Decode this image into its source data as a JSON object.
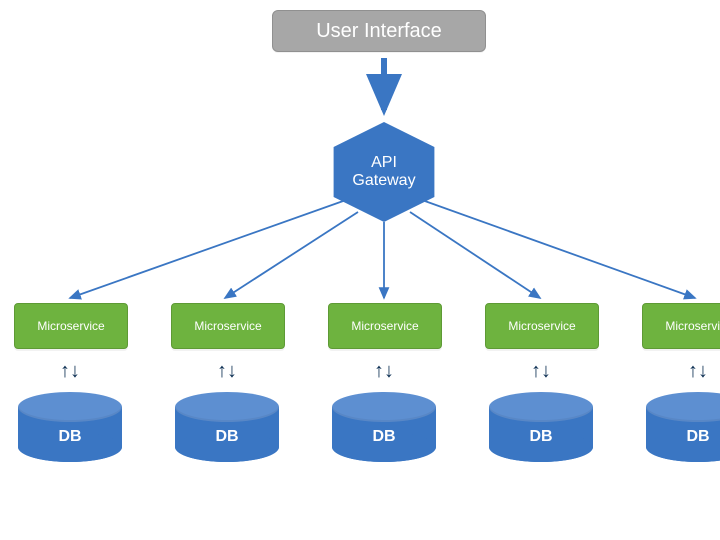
{
  "colors": {
    "ui_box": "#a7a7a7",
    "hexagon": "#3a76c3",
    "microservice": "#6eb33f",
    "db": "#3a76c3",
    "db_top": "#5d8fd1",
    "arrow": "#3a76c3",
    "double_arrow": "#0b2e52"
  },
  "top": {
    "label": "User Interface"
  },
  "gateway": {
    "line1": "API",
    "line2": "Gateway"
  },
  "services": [
    {
      "label": "Microservice",
      "db": "DB"
    },
    {
      "label": "Microservice",
      "db": "DB"
    },
    {
      "label": "Microservice",
      "db": "DB"
    },
    {
      "label": "Microservice",
      "db": "DB"
    },
    {
      "label": "Microservice",
      "db": "DB"
    }
  ]
}
